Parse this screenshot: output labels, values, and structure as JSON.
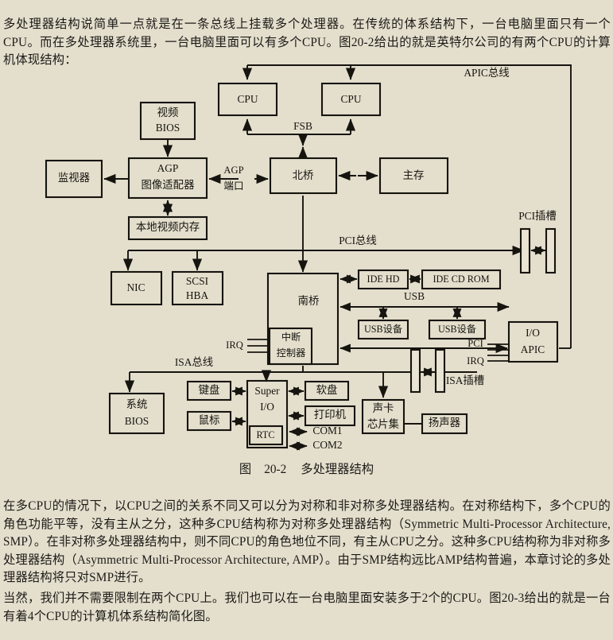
{
  "document": {
    "paragraphs": {
      "intro": "多处理器结构说简单一点就是在一条总线上挂载多个处理器。在传统的体系结构下，一台电脑里面只有一个CPU。而在多处理器系统里，一台电脑里面可以有多个CPU。图20-2给出的就是英特尔公司的有两个CPU的计算机体现结构：",
      "smp": "在多CPU的情况下，以CPU之间的关系不同又可以分为对称和非对称多处理器结构。在对称结构下，多个CPU的角色功能平等，没有主从之分，这种多CPU结构称为对称多处理器结构（Symmetric Multi-Processor Architecture, SMP）。在非对称多处理器结构中，则不同CPU的角色地位不同，有主从CPU之分。这种多CPU结构称为非对称多处理器结构（Asymmetric Multi-Processor Architecture, AMP）。由于SMP结构远比AMP结构普遍，本章讨论的多处理器结构将只对SMP进行。",
      "four_cpu": "当然，我们并不需要限制在两个CPU上。我们也可以在一台电脑里面安装多于2个的CPU。图20-3给出的就是一台有着4个CPU的计算机体系结构简化图。"
    },
    "figure_caption": {
      "prefix": "图",
      "number": "20-2",
      "title": "多处理器结构"
    }
  },
  "diagram": {
    "title": "多处理器结构",
    "nodes": {
      "cpu1": "CPU",
      "cpu2": "CPU",
      "video_bios_l1": "视频",
      "video_bios_l2": "BIOS",
      "monitor": "监视器",
      "agp_l1": "AGP",
      "agp_l2": "图像适配器",
      "northbridge": "北桥",
      "main_memory": "主存",
      "local_video_memory": "本地视频内存",
      "nic": "NIC",
      "scsi_l1": "SCSI",
      "scsi_l2": "HBA",
      "southbridge": "南桥",
      "interrupt_ctrl_l1": "中断",
      "interrupt_ctrl_l2": "控制器",
      "ide_hd": "IDE HD",
      "ide_cdrom": "IDE CD ROM",
      "usb_device_1": "USB设备",
      "usb_device_2": "USB设备",
      "io_apic_l1": "I/O",
      "io_apic_l2": "APIC",
      "system_bios_l1": "系统",
      "system_bios_l2": "BIOS",
      "keyboard": "键盘",
      "mouse": "鼠标",
      "super_io_l1": "Super",
      "super_io_l2": "I/O",
      "rtc": "RTC",
      "floppy": "软盘",
      "printer": "打印机",
      "com1": "COM1",
      "com2": "COM2",
      "sound_card_l1": "声卡",
      "sound_card_l2": "芯片集",
      "speaker": "扬声器"
    },
    "bus_labels": {
      "apic_bus": "APIC总线",
      "fsb": "FSB",
      "agp_port_l1": "AGP",
      "agp_port_l2": "端口",
      "pci_bus": "PCI总线",
      "pci_slot": "PCI插槽",
      "usb": "USB",
      "irq": "IRQ",
      "isa_bus": "ISA总线",
      "isa_slot": "ISA插槽",
      "pci_line": "PCI",
      "irq_line": "IRQ"
    }
  },
  "colors": {
    "page_background": "#e4dfcd",
    "ink": "#16140f",
    "box_fill": "#e9e4d3"
  }
}
